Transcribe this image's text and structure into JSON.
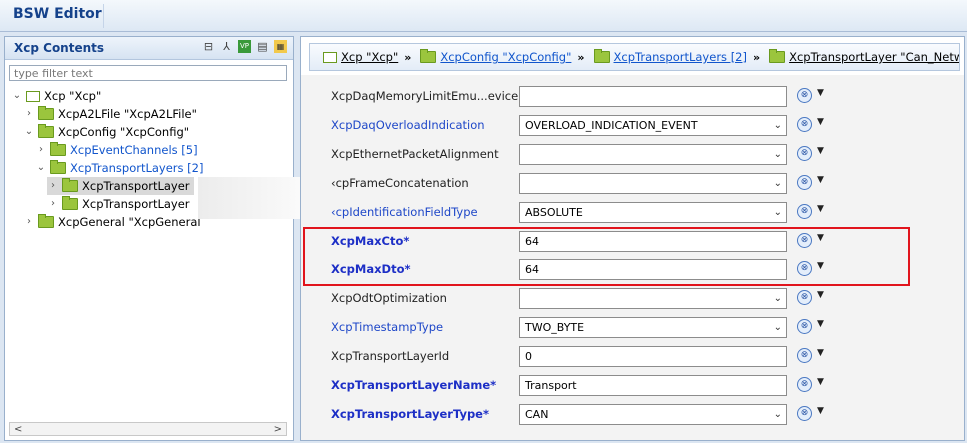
{
  "app": {
    "title": "BSW Editor"
  },
  "left": {
    "title": "Xcp Contents",
    "filter_placeholder": "type filter text",
    "tree": [
      {
        "label": "Xcp \"Xcp\"",
        "twisty": "v",
        "icon": "box",
        "link": false
      },
      {
        "label": "XcpA2LFile \"XcpA2LFile\"",
        "twisty": ">",
        "icon": "folder",
        "link": false
      },
      {
        "label": "XcpConfig \"XcpConfig\"",
        "twisty": "v",
        "icon": "folder",
        "link": false
      },
      {
        "label": "XcpEventChannels [5]",
        "twisty": ">",
        "icon": "folder",
        "link": true
      },
      {
        "label": "XcpTransportLayers [2]",
        "twisty": "v",
        "icon": "folder",
        "link": true
      },
      {
        "label": "XcpTransportLayer",
        "twisty": ">",
        "icon": "folder",
        "link": false,
        "selected": true
      },
      {
        "label": "XcpTransportLayer",
        "twisty": ">",
        "icon": "folder",
        "link": false
      },
      {
        "label": "XcpGeneral \"XcpGeneral",
        "twisty": ">",
        "icon": "folder",
        "link": false
      }
    ]
  },
  "breadcrumb": [
    {
      "label": "Xcp \"Xcp\"",
      "icon": "box",
      "link": false
    },
    {
      "label": "XcpConfig \"XcpConfig\"",
      "icon": "folder",
      "link": true
    },
    {
      "label": "XcpTransportLayers [2]",
      "icon": "folder",
      "link": true
    },
    {
      "label": "XcpTransportLayer \"Can_Network_",
      "icon": "folder",
      "link": false
    }
  ],
  "form": {
    "rows": [
      {
        "label": "XcpDaqMemoryLimitEmu...evice",
        "value": "",
        "style": "plain",
        "dropdown": false
      },
      {
        "label": "XcpDaqOverloadIndication",
        "value": "OVERLOAD_INDICATION_EVENT",
        "style": "link",
        "dropdown": true
      },
      {
        "label": "XcpEthernetPacketAlignment",
        "value": "",
        "style": "plain",
        "dropdown": true
      },
      {
        "label": "‹cpFrameConcatenation",
        "value": "",
        "style": "plain",
        "dropdown": true
      },
      {
        "label": "‹cpIdentificationFieldType",
        "value": "ABSOLUTE",
        "style": "link",
        "dropdown": true
      },
      {
        "label": "XcpMaxCto*",
        "value": "64",
        "style": "bold",
        "dropdown": false
      },
      {
        "label": "XcpMaxDto*",
        "value": "64",
        "style": "bold",
        "dropdown": false
      },
      {
        "label": "XcpOdtOptimization",
        "value": "",
        "style": "plain",
        "dropdown": true
      },
      {
        "label": "XcpTimestampType",
        "value": "TWO_BYTE",
        "style": "link",
        "dropdown": true
      },
      {
        "label": "XcpTransportLayerId",
        "value": "0",
        "style": "plain",
        "dropdown": false
      },
      {
        "label": "XcpTransportLayerName*",
        "value": "Transport",
        "style": "bold",
        "dropdown": false
      },
      {
        "label": "XcpTransportLayerType*",
        "value": "CAN",
        "style": "bold",
        "dropdown": true
      }
    ]
  },
  "colors": {
    "highlight": "#e1141c",
    "title": "#15428b",
    "link": "#1155cc"
  }
}
